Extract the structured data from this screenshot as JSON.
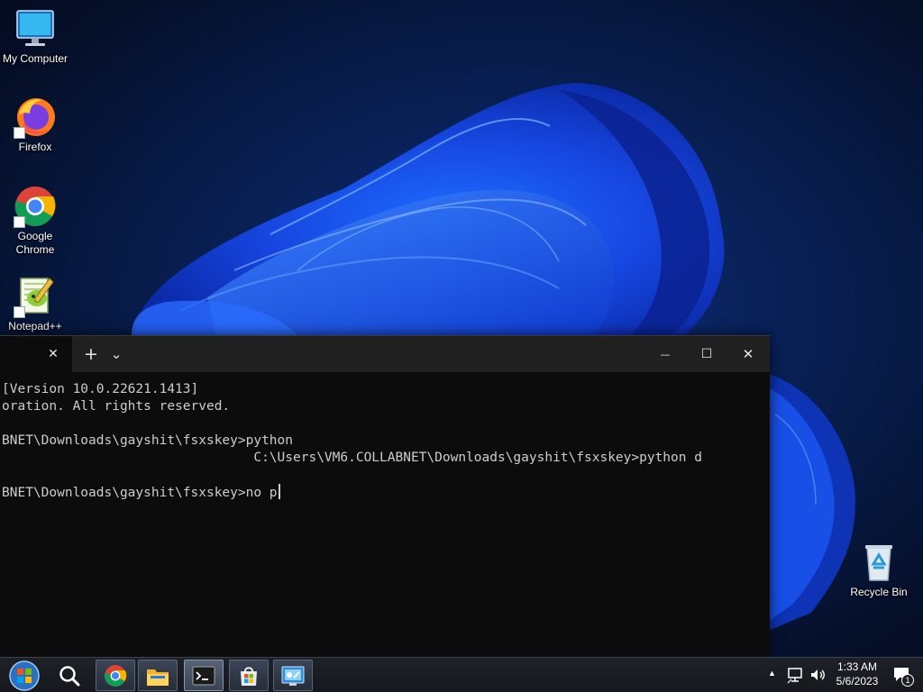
{
  "desktop": {
    "icons": [
      {
        "label": "My Computer",
        "icon": "monitor-icon"
      },
      {
        "label": "Firefox",
        "icon": "firefox-icon"
      },
      {
        "label": "Google Chrome",
        "icon": "chrome-icon"
      },
      {
        "label": "Notepad++",
        "icon": "notepadpp-icon"
      },
      {
        "label": "Recycle Bin",
        "icon": "recycle-bin-icon"
      }
    ]
  },
  "terminal": {
    "tab": {
      "close_glyph": "✕"
    },
    "new_tab_glyph": "+",
    "dropdown_glyph": "⌄",
    "controls": {
      "minimize": "—",
      "maximize": "☐",
      "close": "✕"
    },
    "lines": [
      "[Version 10.0.22621.1413]",
      "oration. All rights reserved.",
      "",
      "BNET\\Downloads\\gayshit\\fsxskey>python",
      "                                C:\\Users\\VM6.COLLABNET\\Downloads\\gayshit\\fsxskey>python d",
      "",
      "BNET\\Downloads\\gayshit\\fsxskey>no p"
    ]
  },
  "taskbar": {
    "pinned": [
      "start-orb-icon",
      "search-icon",
      "chrome-icon",
      "file-explorer-icon",
      "terminal-icon",
      "store-icon",
      "control-panel-icon"
    ],
    "tray": {
      "overflow_glyph": "▲",
      "time": "1:33 AM",
      "date": "5/6/2023",
      "notification_count": "1"
    }
  },
  "colors": {
    "terminal_bg": "#0c0c0c",
    "terminal_titlebar": "#202020",
    "terminal_text": "#cccccc",
    "wallpaper_base": "#071a45"
  }
}
